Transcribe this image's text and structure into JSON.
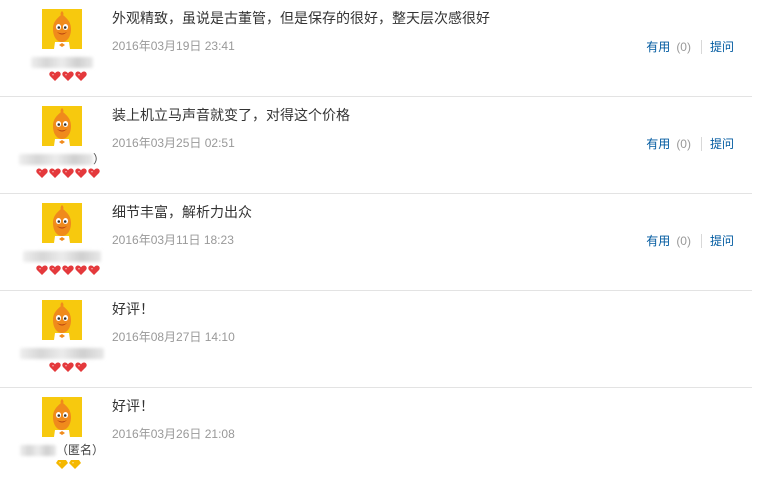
{
  "reviews": [
    {
      "content": "外观精致，虽说是古董管，但是保存的很好，整天层次感很好",
      "date": "2016年03月19日 23:41",
      "username_suffix": "",
      "rank_icon": "red-heart-gem-icon",
      "rank_count": 3,
      "show_actions": true,
      "useful_label": "有用",
      "useful_count": "(0)",
      "reply_label": "提问"
    },
    {
      "content": "装上机立马声音就变了，对得这个价格",
      "date": "2016年03月25日 02:51",
      "username_suffix": "）",
      "rank_icon": "red-heart-gem-icon",
      "rank_count": 5,
      "show_actions": true,
      "useful_label": "有用",
      "useful_count": "(0)",
      "reply_label": "提问"
    },
    {
      "content": "细节丰富，解析力出众",
      "date": "2016年03月11日 18:23",
      "username_suffix": "",
      "rank_icon": "red-heart-gem-icon",
      "rank_count": 5,
      "show_actions": true,
      "useful_label": "有用",
      "useful_count": "(0)",
      "reply_label": "提问"
    },
    {
      "content": "好评！",
      "date": "2016年08月27日 14:10",
      "username_suffix": "",
      "rank_icon": "red-heart-gem-icon",
      "rank_count": 3,
      "show_actions": false,
      "useful_label": "",
      "useful_count": "",
      "reply_label": ""
    },
    {
      "content": "好评！",
      "date": "2016年03月26日 21:08",
      "username_suffix": "（匿名）",
      "rank_icon": "yellow-diamond-icon",
      "rank_count": 2,
      "show_actions": false,
      "useful_label": "",
      "useful_count": "",
      "reply_label": ""
    }
  ],
  "colors": {
    "link": "#005aa0",
    "date": "#999999",
    "divider": "#e3e3e3",
    "avatar_bg": "#f7c90e",
    "mascot_orange": "#f08a1c",
    "heart_red": "#e4393c",
    "diamond_yellow": "#f5b800"
  }
}
